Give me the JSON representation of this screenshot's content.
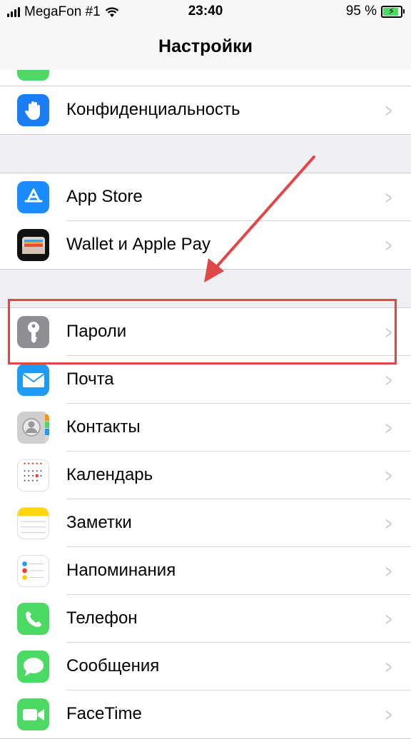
{
  "status_bar": {
    "carrier": "MegaFon #1",
    "time": "23:40",
    "battery_percent": "95 %",
    "battery_level": 0.95
  },
  "nav": {
    "title": "Настройки"
  },
  "groups": {
    "privacy": {
      "items": [
        {
          "label": "Конфиденциальность",
          "icon": "hand-icon"
        }
      ]
    },
    "store": {
      "items": [
        {
          "label": "App Store",
          "icon": "app-store-icon"
        },
        {
          "label": "Wallet и Apple Pay",
          "icon": "wallet-icon"
        }
      ]
    },
    "apps": {
      "items": [
        {
          "label": "Пароли",
          "icon": "key-icon"
        },
        {
          "label": "Почта",
          "icon": "mail-icon"
        },
        {
          "label": "Контакты",
          "icon": "contacts-icon"
        },
        {
          "label": "Календарь",
          "icon": "calendar-icon"
        },
        {
          "label": "Заметки",
          "icon": "notes-icon"
        },
        {
          "label": "Напоминания",
          "icon": "reminders-icon"
        },
        {
          "label": "Телефон",
          "icon": "phone-icon"
        },
        {
          "label": "Сообщения",
          "icon": "messages-icon"
        },
        {
          "label": "FaceTime",
          "icon": "facetime-icon"
        }
      ]
    }
  },
  "colors": {
    "accent_highlight": "#e04848",
    "privacy_icon": "#1b7cf3",
    "app_store_icon": "#1a8cff",
    "passwords_icon": "#8e8e93",
    "mail_icon": "#1e9bf5",
    "phone_icon": "#4cd964",
    "messages_icon": "#4cd964",
    "facetime_icon": "#4cd964"
  }
}
